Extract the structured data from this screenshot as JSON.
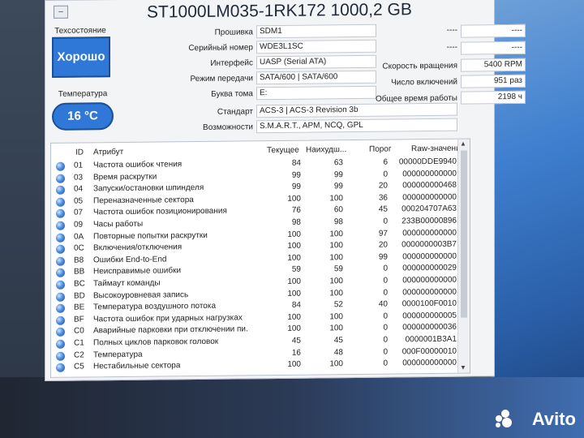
{
  "window": {
    "title": "ST1000LM035-1RK172 1000,2 GB",
    "sys_button": "–"
  },
  "health": {
    "label": "Техсостояние",
    "value": "Хорошо",
    "color": "#2f78d8"
  },
  "temperature": {
    "label": "Температура",
    "value": "16 °C"
  },
  "info": {
    "firmware": {
      "label": "Прошивка",
      "value": "SDM1"
    },
    "serial": {
      "label": "Серийный номер",
      "value": "WDE3L1SC"
    },
    "interface": {
      "label": "Интерфейс",
      "value": "UASP (Serial ATA)"
    },
    "transfer": {
      "label": "Режим передачи",
      "value": "SATA/600 | SATA/600"
    },
    "volume": {
      "label": "Буква тома",
      "value": "E:"
    },
    "standard": {
      "label": "Стандарт",
      "value": "ACS-3 | ACS-3 Revision 3b"
    },
    "features": {
      "label": "Возможности",
      "value": "S.M.A.R.T., APM, NCQ, GPL"
    }
  },
  "right_info": {
    "blank1": "----",
    "blank1b": "----",
    "blank2": "----",
    "blank2b": "----",
    "rotation": {
      "label": "Скорость вращения",
      "value": "5400 RPM"
    },
    "power_count": {
      "label": "Число включений",
      "value": "951 раз"
    },
    "power_hours": {
      "label": "Общее время работы",
      "value": "2198 ч"
    }
  },
  "table": {
    "headers": {
      "id": "ID",
      "attr": "Атрибут",
      "cur": "Текущее",
      "worst": "Наихудш...",
      "thr": "Порог",
      "raw": "Raw-значения"
    },
    "rows": [
      {
        "id": "01",
        "attr": "Частота ошибок чтения",
        "cur": "84",
        "worst": "63",
        "thr": "6",
        "raw": "00000DDE9940"
      },
      {
        "id": "03",
        "attr": "Время раскрутки",
        "cur": "99",
        "worst": "99",
        "thr": "0",
        "raw": "000000000000"
      },
      {
        "id": "04",
        "attr": "Запуски/остановки шпинделя",
        "cur": "99",
        "worst": "99",
        "thr": "20",
        "raw": "000000000468"
      },
      {
        "id": "05",
        "attr": "Переназначенные сектора",
        "cur": "100",
        "worst": "100",
        "thr": "36",
        "raw": "000000000000"
      },
      {
        "id": "07",
        "attr": "Частота ошибок позиционирования",
        "cur": "76",
        "worst": "60",
        "thr": "45",
        "raw": "000204707A63"
      },
      {
        "id": "09",
        "attr": "Часы работы",
        "cur": "98",
        "worst": "98",
        "thr": "0",
        "raw": "233B00000896"
      },
      {
        "id": "0A",
        "attr": "Повторные попытки раскрутки",
        "cur": "100",
        "worst": "100",
        "thr": "97",
        "raw": "000000000000"
      },
      {
        "id": "0C",
        "attr": "Включения/отключения",
        "cur": "100",
        "worst": "100",
        "thr": "20",
        "raw": "0000000003B7"
      },
      {
        "id": "B8",
        "attr": "Ошибки End-to-End",
        "cur": "100",
        "worst": "100",
        "thr": "99",
        "raw": "000000000000"
      },
      {
        "id": "BB",
        "attr": "Неисправимые ошибки",
        "cur": "59",
        "worst": "59",
        "thr": "0",
        "raw": "000000000029"
      },
      {
        "id": "BC",
        "attr": "Таймаут команды",
        "cur": "100",
        "worst": "100",
        "thr": "0",
        "raw": "000000000000"
      },
      {
        "id": "BD",
        "attr": "Высокоуровневая запись",
        "cur": "100",
        "worst": "100",
        "thr": "0",
        "raw": "000000000000"
      },
      {
        "id": "BE",
        "attr": "Температура воздушного потока",
        "cur": "84",
        "worst": "52",
        "thr": "40",
        "raw": "0000100F0010"
      },
      {
        "id": "BF",
        "attr": "Частота ошибок при ударных нагрузках",
        "cur": "100",
        "worst": "100",
        "thr": "0",
        "raw": "000000000005"
      },
      {
        "id": "C0",
        "attr": "Аварийные парковки при отключении пи...",
        "cur": "100",
        "worst": "100",
        "thr": "0",
        "raw": "000000000036"
      },
      {
        "id": "C1",
        "attr": "Полных циклов парковок головок",
        "cur": "45",
        "worst": "45",
        "thr": "0",
        "raw": "0000001B3A1"
      },
      {
        "id": "C2",
        "attr": "Температура",
        "cur": "16",
        "worst": "48",
        "thr": "0",
        "raw": "000F00000010"
      },
      {
        "id": "C5",
        "attr": "Нестабильные сектора",
        "cur": "100",
        "worst": "100",
        "thr": "0",
        "raw": "000000000000"
      }
    ]
  },
  "watermark": {
    "text": "Avito"
  }
}
